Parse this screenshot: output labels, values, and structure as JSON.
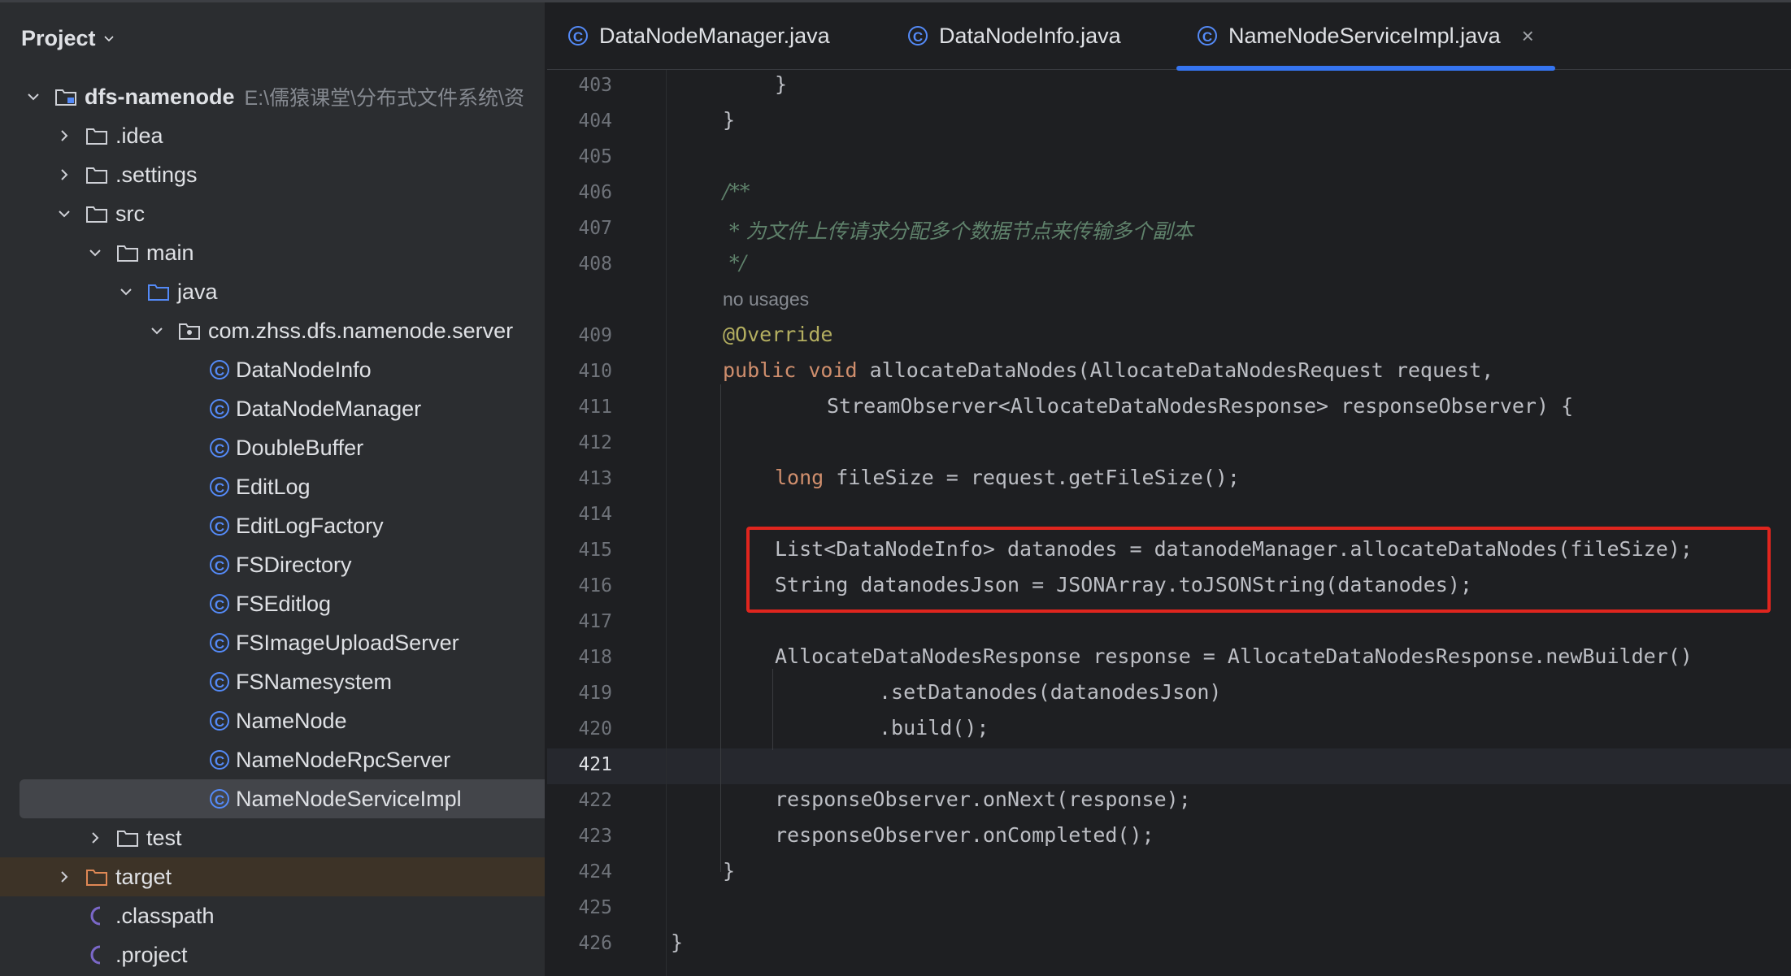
{
  "sidebar": {
    "title": "Project",
    "tree": [
      {
        "label": "dfs-namenode",
        "hint": "E:\\儒猿课堂\\分布式文件系统\\资",
        "icon": "module-folder-icon",
        "expanded": true
      },
      {
        "label": ".idea",
        "icon": "folder-icon",
        "expanded": false
      },
      {
        "label": ".settings",
        "icon": "folder-icon",
        "expanded": false
      },
      {
        "label": "src",
        "icon": "folder-icon",
        "expanded": true
      },
      {
        "label": "main",
        "icon": "folder-icon",
        "expanded": true
      },
      {
        "label": "java",
        "icon": "source-folder-icon",
        "expanded": true
      },
      {
        "label": "com.zhss.dfs.namenode.server",
        "icon": "package-icon",
        "expanded": true
      },
      {
        "label": "DataNodeInfo",
        "icon": "class-icon"
      },
      {
        "label": "DataNodeManager",
        "icon": "class-icon"
      },
      {
        "label": "DoubleBuffer",
        "icon": "class-icon"
      },
      {
        "label": "EditLog",
        "icon": "class-icon"
      },
      {
        "label": "EditLogFactory",
        "icon": "class-icon"
      },
      {
        "label": "FSDirectory",
        "icon": "class-icon"
      },
      {
        "label": "FSEditlog",
        "icon": "class-icon"
      },
      {
        "label": "FSImageUploadServer",
        "icon": "class-icon"
      },
      {
        "label": "FSNamesystem",
        "icon": "class-icon"
      },
      {
        "label": "NameNode",
        "icon": "class-icon"
      },
      {
        "label": "NameNodeRpcServer",
        "icon": "class-icon"
      },
      {
        "label": "NameNodeServiceImpl",
        "icon": "class-icon",
        "selected": true
      },
      {
        "label": "test",
        "icon": "folder-icon",
        "expanded": false
      },
      {
        "label": "target",
        "icon": "excluded-folder-icon",
        "expanded": false
      },
      {
        "label": ".classpath",
        "icon": "eclipse-file-icon"
      },
      {
        "label": ".project",
        "icon": "eclipse-file-icon"
      }
    ]
  },
  "tabs": [
    {
      "label": "DataNodeManager.java",
      "active": false
    },
    {
      "label": "DataNodeInfo.java",
      "active": false
    },
    {
      "label": "NameNodeServiceImpl.java",
      "active": true,
      "close": "×"
    }
  ],
  "editor": {
    "current_line": "421",
    "no_usages_hint": "no usages",
    "lines": [
      {
        "num": "403",
        "code": "}"
      },
      {
        "num": "404",
        "code": "}"
      },
      {
        "num": "405",
        "code": ""
      },
      {
        "num": "406",
        "code": "/**"
      },
      {
        "num": "407",
        "code": " * 为文件上传请求分配多个数据节点来传输多个副本"
      },
      {
        "num": "408",
        "code": " */"
      },
      {
        "num": "409",
        "code": "@Override"
      },
      {
        "num": "410",
        "code": "public void allocateDataNodes(AllocateDataNodesRequest request,"
      },
      {
        "num": "411",
        "code": "StreamObserver<AllocateDataNodesResponse> responseObserver) {"
      },
      {
        "num": "412",
        "code": ""
      },
      {
        "num": "413",
        "code": "long fileSize = request.getFileSize();"
      },
      {
        "num": "414",
        "code": ""
      },
      {
        "num": "415",
        "code": "List<DataNodeInfo> datanodes = datanodeManager.allocateDataNodes(fileSize);"
      },
      {
        "num": "416",
        "code": "String datanodesJson = JSONArray.toJSONString(datanodes);"
      },
      {
        "num": "417",
        "code": ""
      },
      {
        "num": "418",
        "code": "AllocateDataNodesResponse response = AllocateDataNodesResponse.newBuilder()"
      },
      {
        "num": "419",
        "code": ".setDatanodes(datanodesJson)"
      },
      {
        "num": "420",
        "code": ".build();"
      },
      {
        "num": "421",
        "code": ""
      },
      {
        "num": "422",
        "code": "responseObserver.onNext(response);"
      },
      {
        "num": "423",
        "code": "responseObserver.onCompleted();"
      },
      {
        "num": "424",
        "code": "}"
      },
      {
        "num": "425",
        "code": ""
      },
      {
        "num": "426",
        "code": "}"
      }
    ]
  },
  "colors": {
    "accent": "#3574f0",
    "highlight_box": "#e0251e",
    "keyword": "#cf8e6d",
    "comment": "#5f826b",
    "annotation": "#b3ae60"
  }
}
